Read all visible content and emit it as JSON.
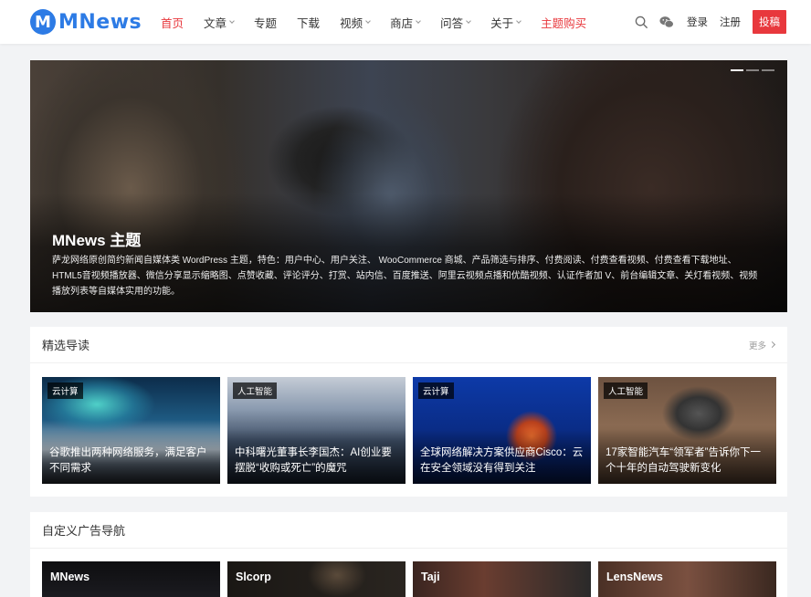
{
  "header": {
    "logo_mark": "M",
    "logo_text": "MNews",
    "nav": [
      {
        "label": "首页",
        "active": true,
        "dropdown": false
      },
      {
        "label": "文章",
        "dropdown": true
      },
      {
        "label": "专题",
        "dropdown": false
      },
      {
        "label": "下载",
        "dropdown": false
      },
      {
        "label": "视频",
        "dropdown": true
      },
      {
        "label": "商店",
        "dropdown": true
      },
      {
        "label": "问答",
        "dropdown": true
      },
      {
        "label": "关于",
        "dropdown": true
      },
      {
        "label": "主题购买",
        "hot": true,
        "dropdown": false
      }
    ],
    "login": "登录",
    "register": "注册",
    "submit": "投稿",
    "icons": [
      "search-icon",
      "wechat-icon"
    ]
  },
  "hero": {
    "title": "MNews 主题",
    "description": "萨龙网络原创简约新闻自媒体类 WordPress 主题，特色：用户中心、用户关注、 WooCommerce 商城、产品筛选与排序、付费阅读、付费查看视频、付费查看下载地址、HTML5音视频播放器、微信分享显示缩略图、点赞收藏、评论评分、打赏、站内信、百度推送、阿里云视频点播和优酷视频、认证作者加 V、前台编辑文章、关灯看视频、视频播放列表等自媒体实用的功能。",
    "slides": 3,
    "active_slide": 0
  },
  "featured": {
    "title": "精选导读",
    "more": "更多",
    "cards": [
      {
        "tag": "云计算",
        "title": "谷歌推出两种网络服务，满足客户不同需求"
      },
      {
        "tag": "人工智能",
        "title": "中科曙光董事长李国杰：AI创业要摆脱“收购或死亡”的魔咒"
      },
      {
        "tag": "云计算",
        "title": "全球网络解决方案供应商Cisco：云在安全领域没有得到关注"
      },
      {
        "tag": "人工智能",
        "title": "17家智能汽车“领军者”告诉你下一个十年的自动驾驶新变化"
      }
    ]
  },
  "ads": {
    "title": "自定义广告导航",
    "cards": [
      {
        "title": "MNews"
      },
      {
        "title": "Slcorp"
      },
      {
        "title": "Taji"
      },
      {
        "title": "LensNews"
      }
    ]
  },
  "colors": {
    "accent": "#e8383d",
    "brand": "#2d7be5"
  }
}
